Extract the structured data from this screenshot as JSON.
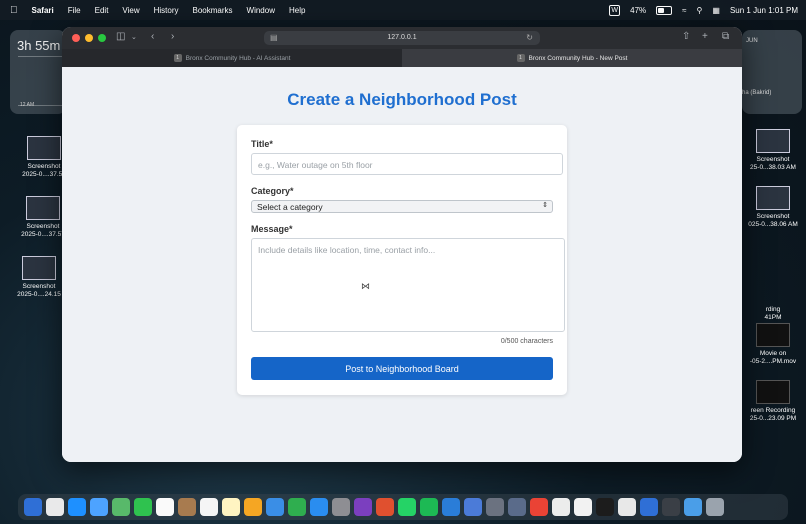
{
  "menubar": {
    "app_name": "Safari",
    "menus": [
      "File",
      "Edit",
      "View",
      "History",
      "Bookmarks",
      "Window",
      "Help"
    ],
    "battery": "47%",
    "datetime": "Sun 1 Jun  1:01 PM",
    "w_badge": "W"
  },
  "desktop": {
    "widget_time": "3h 55m",
    "widget_tick": "12 AM",
    "right_widget_month": "JUN",
    "right_widget_event": "ha (Bakrid)",
    "left_icons": [
      {
        "name": "Screenshot",
        "sub": "2025-0....37.53"
      },
      {
        "name": "Screenshot",
        "sub": "2025-0....37.57"
      },
      {
        "name": "Screenshot",
        "sub": "2025-0....24.15"
      }
    ],
    "right_icons": [
      {
        "name": "Screenshot",
        "sub": "25-0...38.03 AM"
      },
      {
        "name": "Screenshot",
        "sub": "025-0...38.06 AM"
      },
      {
        "name": "rding",
        "sub": "41PM"
      },
      {
        "name": "Movie on",
        "sub": "-05-2....PM.mov"
      },
      {
        "name": "reen Recording",
        "sub": "25-0...23.09 PM"
      }
    ]
  },
  "browser": {
    "url": "127.0.0.1",
    "tabs": [
      {
        "label": "Bronx Community Hub - AI Assistant",
        "active": false
      },
      {
        "label": "Bronx Community Hub - New Post",
        "active": true
      }
    ]
  },
  "page": {
    "title": "Create a Neighborhood Post",
    "form": {
      "title_label": "Title*",
      "title_placeholder": "e.g., Water outage on 5th floor",
      "category_label": "Category*",
      "category_selected": "Select a category",
      "message_label": "Message*",
      "message_placeholder": "Include details like location, time, contact info...",
      "char_count": "0/500 characters",
      "submit_label": "Post to Neighborhood Board"
    }
  },
  "colors": {
    "accent": "#1565c8",
    "title": "#1f6fd0"
  }
}
